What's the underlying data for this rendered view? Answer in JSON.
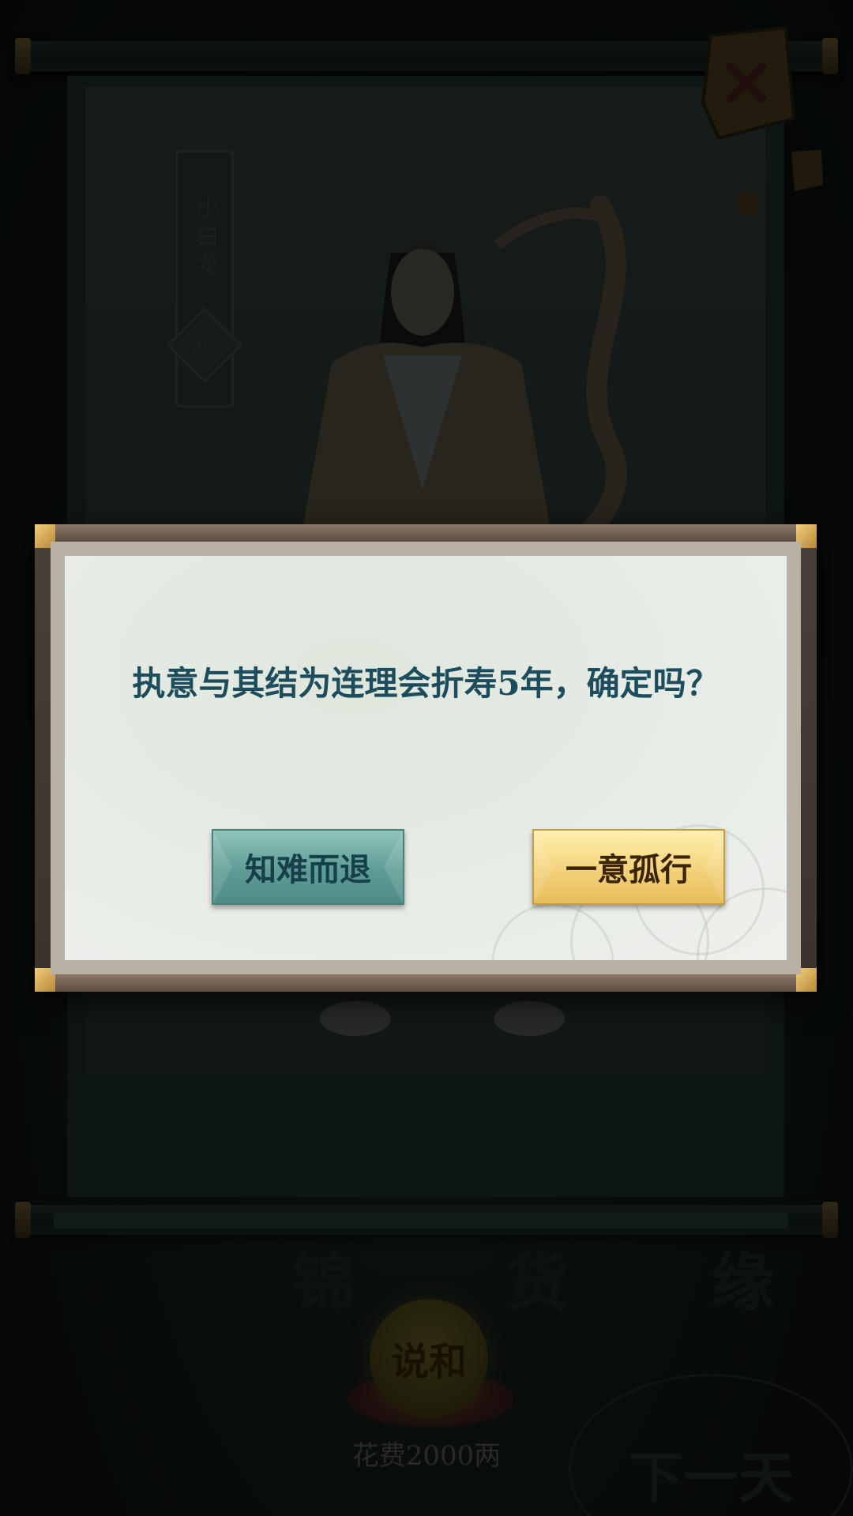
{
  "background": {
    "character": {
      "name": "小白龙",
      "status": "和"
    },
    "bottom_labels": [
      "锦",
      "货",
      "缘"
    ],
    "talk_button_label": "说和",
    "cost_text": "花费2000两",
    "next_button_label": "下一天"
  },
  "dialog": {
    "message": "执意与其结为连理会折寿5年，确定吗？",
    "cancel_label": "知难而退",
    "confirm_label": "一意孤行"
  },
  "colors": {
    "dialog_text": "#1d4d5c",
    "cancel_button": "#5d9c95",
    "confirm_button": "#f3d27a"
  }
}
